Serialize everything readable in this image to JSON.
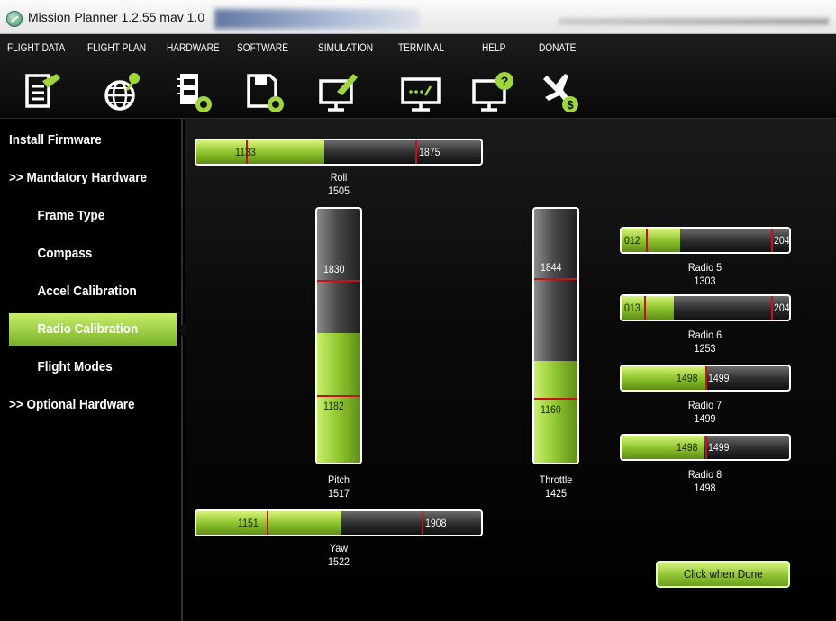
{
  "window": {
    "title": "Mission Planner 1.2.55 mav 1.0"
  },
  "toolbar": {
    "items": [
      {
        "label": "FLIGHT DATA",
        "icon": "flight-data-icon"
      },
      {
        "label": "FLIGHT PLAN",
        "icon": "globe-icon"
      },
      {
        "label": "HARDWARE",
        "icon": "hardware-chip-icon"
      },
      {
        "label": "SOFTWARE",
        "icon": "save-disk-icon"
      },
      {
        "label": "SIMULATION",
        "icon": "simulation-monitor-icon"
      },
      {
        "label": "TERMINAL",
        "icon": "terminal-icon"
      },
      {
        "label": "HELP",
        "icon": "help-icon"
      },
      {
        "label": "DONATE",
        "icon": "donate-plane-icon"
      }
    ]
  },
  "sidebar": {
    "items": [
      {
        "label": "Install Firmware"
      },
      {
        "label": ">> Mandatory Hardware"
      },
      {
        "label": "Frame Type"
      },
      {
        "label": "Compass"
      },
      {
        "label": "Accel Calibration"
      },
      {
        "label": "Radio Calibration"
      },
      {
        "label": "Flight Modes"
      },
      {
        "label": ">> Optional Hardware"
      }
    ],
    "active": "Radio Calibration"
  },
  "channels": {
    "roll": {
      "name": "Roll",
      "value": "1505",
      "min": "1133",
      "max": "1875",
      "fill": 0.45
    },
    "pitch": {
      "name": "Pitch",
      "value": "1517",
      "min": "1182",
      "max": "1830",
      "fill": 0.51
    },
    "throttle": {
      "name": "Throttle",
      "value": "1425",
      "min": "1160",
      "max": "1844",
      "fill": 0.4
    },
    "yaw": {
      "name": "Yaw",
      "value": "1522",
      "min": "1151",
      "max": "1908",
      "fill": 0.51
    },
    "radio5": {
      "name": "Radio 5",
      "value": "1303",
      "min": "012",
      "max": "204",
      "fill": 0.35
    },
    "radio6": {
      "name": "Radio 6",
      "value": "1253",
      "min": "013",
      "max": "204",
      "fill": 0.31
    },
    "radio7": {
      "name": "Radio 7",
      "value": "1499",
      "min": "1498",
      "max": "1499",
      "fill": 0.5
    },
    "radio8": {
      "name": "Radio 8",
      "value": "1498",
      "min": "1498",
      "max": "1499",
      "fill": 0.49
    }
  },
  "done_button": {
    "label": "Click when Done"
  },
  "colors": {
    "accent_green": "#8ec62f",
    "marker_red": "#c3121a",
    "background": "#000000"
  }
}
